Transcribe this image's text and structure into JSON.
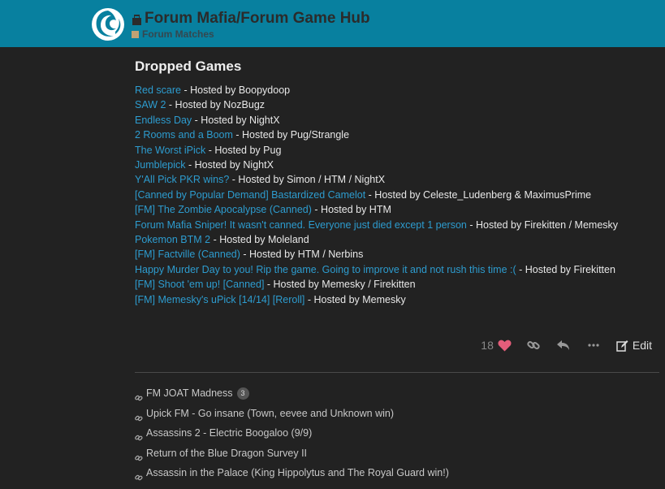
{
  "header": {
    "site_title": "Forum Mafia/Forum Game Hub",
    "category": "Forum Matches",
    "colors": {
      "bar": "#08809f",
      "category_square": "#c2a274"
    }
  },
  "post": {
    "heading": "Dropped Games",
    "games": [
      {
        "title": "Red scare",
        "host": " - Hosted by Boopydoop"
      },
      {
        "title": "SAW 2",
        "host": " - Hosted by NozBugz"
      },
      {
        "title": "Endless Day",
        "host": " - Hosted by NightX"
      },
      {
        "title": "2 Rooms and a Boom",
        "host": " - Hosted by Pug/Strangle"
      },
      {
        "title": "The Worst iPick",
        "host": " - Hosted by Pug"
      },
      {
        "title": "Jumblepick",
        "host": " - Hosted by NightX"
      },
      {
        "title": "Y'All Pick PKR wins?",
        "host": " - Hosted by Simon / HTM / NightX"
      },
      {
        "title": "[Canned by Popular Demand] Bastardized Camelot",
        "host": " - Hosted by Celeste_Ludenberg & MaximusPrime"
      },
      {
        "title": "[FM] The Zombie Apocalypse (Canned)",
        "host": " - Hosted by HTM"
      },
      {
        "title": "Forum Mafia Sniper! It wasn't canned. Everyone just died except 1 person",
        "host": " - Hosted by Firekitten / Memesky"
      },
      {
        "title": "Pokemon BTM 2",
        "host": " - Hosted by Moleland"
      },
      {
        "title": "[FM] Factville (Canned)",
        "host": " - Hosted by HTM / Nerbins"
      },
      {
        "title": "Happy Murder Day to you! Rip the game. Going to improve it and not rush this time :(",
        "host": " - Hosted by Firekitten"
      },
      {
        "title": "[FM] Shoot 'em up! [Canned]",
        "host": " - Hosted by Memesky / Firekitten"
      },
      {
        "title": "[FM] Memesky's uPick [14/14] [Reroll]",
        "host": " - Hosted by Memesky"
      }
    ],
    "actions": {
      "like_count": "18",
      "edit_label": "Edit",
      "icons": [
        "heart-icon",
        "link-icon",
        "reply-icon",
        "more-icon",
        "edit-icon"
      ],
      "heart_color": "#e45d7a"
    }
  },
  "linked_topics": [
    {
      "title": "FM JOAT Madness",
      "count": "3"
    },
    {
      "title": "Upick FM - Go insane (Town, eevee and Unknown win)"
    },
    {
      "title": "Assassins 2 - Electric Boogaloo (9/9)"
    },
    {
      "title": "Return of the Blue Dragon Survey II"
    },
    {
      "title": "Assassin in the Palace (King Hippolytus and The Royal Guard win!)"
    }
  ]
}
